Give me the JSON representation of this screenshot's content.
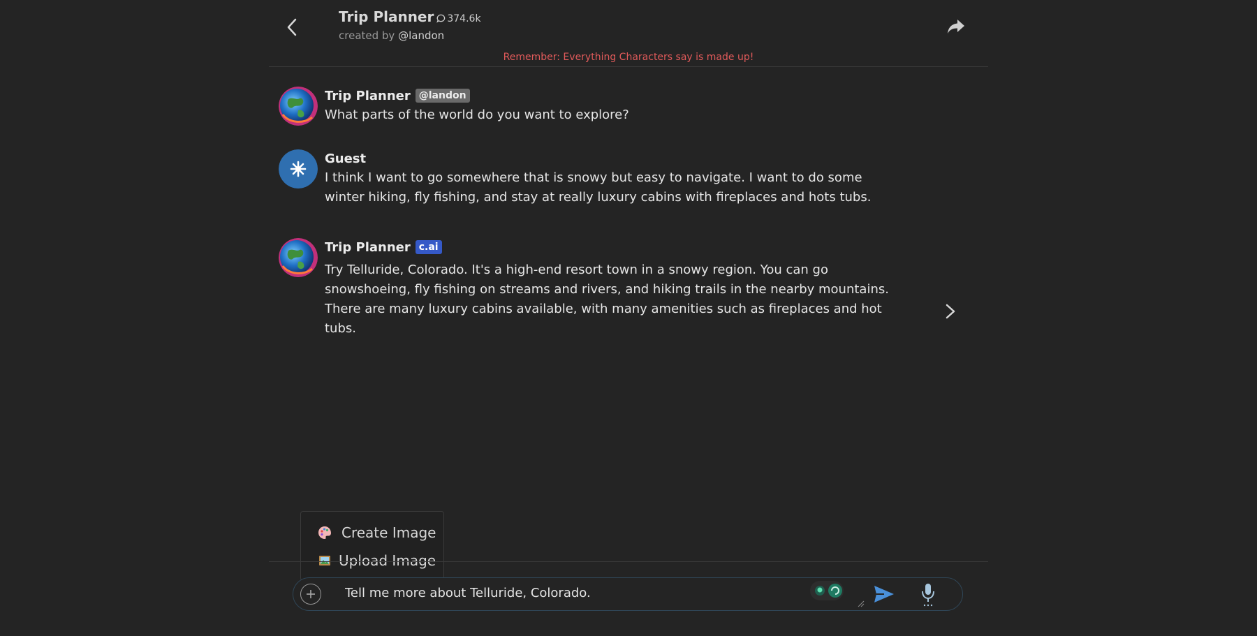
{
  "header": {
    "title": "Trip Planner",
    "chat_count": "374.6k",
    "created_prefix": "created by",
    "creator": "@landon",
    "disclaimer": "Remember: Everything Characters say is made up!"
  },
  "messages": [
    {
      "author": "Trip Planner",
      "tag": "@landon",
      "text": "What parts of the world do you want to explore?"
    },
    {
      "author": "Guest",
      "tag": "",
      "text": "I think I want to go somewhere that is snowy but easy to navigate. I want to do some winter hiking, fly fishing, and stay at really luxury cabins with fireplaces and hots tubs."
    },
    {
      "author": "Trip Planner",
      "tag": "c.ai",
      "text": "Try Telluride, Colorado. It's a high-end resort town in a snowy region. You can go snowshoeing, fly fishing on streams and rivers, and hiking trails in the nearby mountains. There are many luxury cabins available, with many amenities such as fireplaces and hot tubs."
    }
  ],
  "image_menu": {
    "create_label": "Create Image",
    "upload_label": "Upload Image"
  },
  "composer": {
    "value": "Tell me more about Telluride, Colorado."
  },
  "colors": {
    "background": "#242424",
    "disclaimer": "#e05a5a",
    "cai_tag": "#3559c7",
    "guest_avatar": "#2f6fb0",
    "send_icon": "#4a90d9"
  }
}
